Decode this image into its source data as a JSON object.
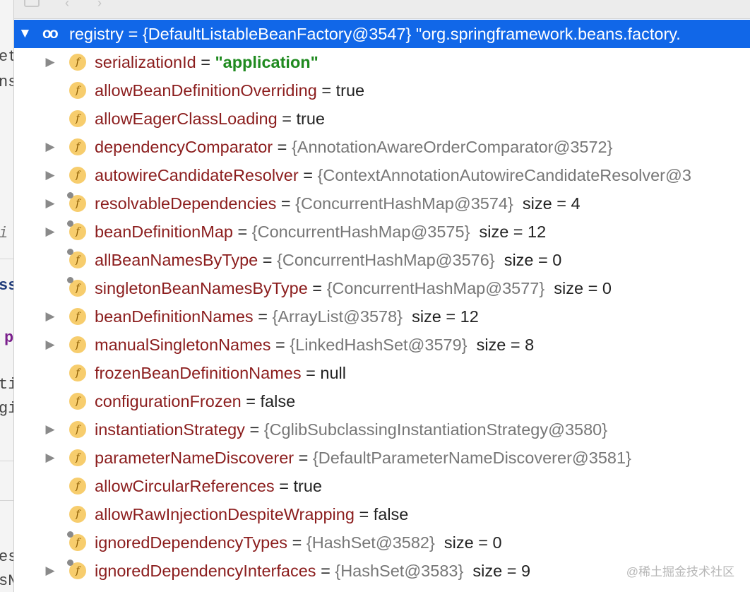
{
  "editor_strip": {
    "fragments": [
      "et",
      "ns",
      "i",
      "ss",
      "p",
      "ti",
      "gis",
      "es",
      "sN"
    ]
  },
  "tree": {
    "root": {
      "name": "registry",
      "equals": " = ",
      "value": "{DefaultListableBeanFactory@3547} \"org.springframework.beans.factory."
    },
    "fields": [
      {
        "name": "serializationId",
        "equals": " = ",
        "value": "\"application\"",
        "kind": "string",
        "expandable": true,
        "pinned": false
      },
      {
        "name": "allowBeanDefinitionOverriding",
        "equals": " = ",
        "value": "true",
        "kind": "plain",
        "expandable": false,
        "pinned": false
      },
      {
        "name": "allowEagerClassLoading",
        "equals": " = ",
        "value": "true",
        "kind": "plain",
        "expandable": false,
        "pinned": false
      },
      {
        "name": "dependencyComparator",
        "equals": " = ",
        "value": "{AnnotationAwareOrderComparator@3572}",
        "kind": "ref",
        "expandable": true,
        "pinned": false
      },
      {
        "name": "autowireCandidateResolver",
        "equals": " = ",
        "value": "{ContextAnnotationAutowireCandidateResolver@3",
        "kind": "ref",
        "expandable": true,
        "pinned": false
      },
      {
        "name": "resolvableDependencies",
        "equals": " = ",
        "value": "{ConcurrentHashMap@3574}",
        "extra": "  size = 4",
        "kind": "ref",
        "expandable": true,
        "pinned": true
      },
      {
        "name": "beanDefinitionMap",
        "equals": " = ",
        "value": "{ConcurrentHashMap@3575}",
        "extra": "  size = 12",
        "kind": "ref",
        "expandable": true,
        "pinned": true
      },
      {
        "name": "allBeanNamesByType",
        "equals": " = ",
        "value": "{ConcurrentHashMap@3576}",
        "extra": "  size = 0",
        "kind": "ref",
        "expandable": false,
        "pinned": true
      },
      {
        "name": "singletonBeanNamesByType",
        "equals": " = ",
        "value": "{ConcurrentHashMap@3577}",
        "extra": "  size = 0",
        "kind": "ref",
        "expandable": false,
        "pinned": true
      },
      {
        "name": "beanDefinitionNames",
        "equals": " = ",
        "value": "{ArrayList@3578}",
        "extra": "  size = 12",
        "kind": "ref",
        "expandable": true,
        "pinned": false
      },
      {
        "name": "manualSingletonNames",
        "equals": " = ",
        "value": "{LinkedHashSet@3579}",
        "extra": "  size = 8",
        "kind": "ref",
        "expandable": true,
        "pinned": false
      },
      {
        "name": "frozenBeanDefinitionNames",
        "equals": " = ",
        "value": "null",
        "kind": "plain",
        "expandable": false,
        "pinned": false
      },
      {
        "name": "configurationFrozen",
        "equals": " = ",
        "value": "false",
        "kind": "plain",
        "expandable": false,
        "pinned": false
      },
      {
        "name": "instantiationStrategy",
        "equals": " = ",
        "value": "{CglibSubclassingInstantiationStrategy@3580}",
        "kind": "ref",
        "expandable": true,
        "pinned": false
      },
      {
        "name": "parameterNameDiscoverer",
        "equals": " = ",
        "value": "{DefaultParameterNameDiscoverer@3581}",
        "kind": "ref",
        "expandable": true,
        "pinned": false
      },
      {
        "name": "allowCircularReferences",
        "equals": " = ",
        "value": "true",
        "kind": "plain",
        "expandable": false,
        "pinned": false
      },
      {
        "name": "allowRawInjectionDespiteWrapping",
        "equals": " = ",
        "value": "false",
        "kind": "plain",
        "expandable": false,
        "pinned": false
      },
      {
        "name": "ignoredDependencyTypes",
        "equals": " = ",
        "value": "{HashSet@3582}",
        "extra": "  size = 0",
        "kind": "ref",
        "expandable": false,
        "pinned": true
      },
      {
        "name": "ignoredDependencyInterfaces",
        "equals": " = ",
        "value": "{HashSet@3583}",
        "extra": "  size = 9",
        "kind": "ref",
        "expandable": true,
        "pinned": true
      }
    ]
  },
  "watermark": "@稀土掘金技术社区",
  "colors": {
    "selection": "#1167e8",
    "field_name": "#8b1d1d",
    "string_value": "#1f8a1f",
    "reference_value": "#777777",
    "field_icon": "#f7cd6d"
  }
}
